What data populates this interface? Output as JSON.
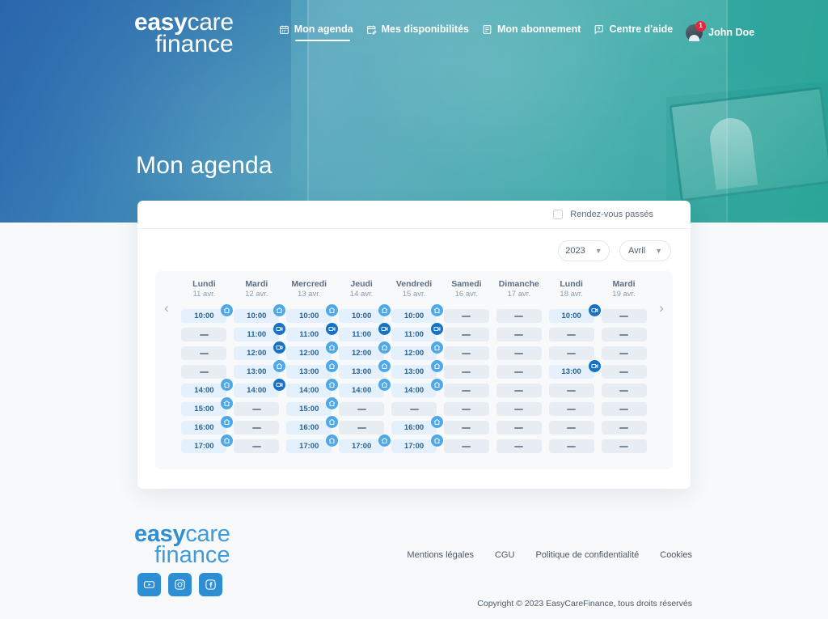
{
  "brand": {
    "logo_line1_bold": "easy",
    "logo_line1_light": "care",
    "logo_line2": "finance"
  },
  "nav": {
    "items": [
      {
        "label": "Mon agenda",
        "icon": "calendar-icon",
        "active": true
      },
      {
        "label": "Mes disponibilités",
        "icon": "calendar-edit-icon",
        "active": false
      },
      {
        "label": "Mon abonnement",
        "icon": "card-icon",
        "active": false
      },
      {
        "label": "Centre d'aide",
        "icon": "help-chat-icon",
        "active": false
      }
    ],
    "user": {
      "name": "John Doe",
      "badge_count": "1"
    }
  },
  "hero": {
    "page_title": "Mon agenda"
  },
  "card": {
    "past_appointments_label": "Rendez-vous passés",
    "past_appointments_checked": false,
    "year_select": {
      "value": "2023"
    },
    "month_select": {
      "value": "Avril"
    },
    "prev_arrow": "‹",
    "next_arrow": "›",
    "columns": [
      {
        "day": "Lundi",
        "date": "11 avr.",
        "slots": [
          {
            "time": "10:00",
            "state": "booked",
            "icon": "home"
          },
          {
            "time": "",
            "state": "free",
            "icon": ""
          },
          {
            "time": "",
            "state": "free",
            "icon": ""
          },
          {
            "time": "",
            "state": "free",
            "icon": ""
          },
          {
            "time": "14:00",
            "state": "booked",
            "icon": "home"
          },
          {
            "time": "15:00",
            "state": "booked",
            "icon": "home"
          },
          {
            "time": "16:00",
            "state": "booked",
            "icon": "home"
          },
          {
            "time": "17:00",
            "state": "booked",
            "icon": "home"
          }
        ]
      },
      {
        "day": "Mardi",
        "date": "12 avr.",
        "slots": [
          {
            "time": "10:00",
            "state": "booked",
            "icon": "home"
          },
          {
            "time": "11:00",
            "state": "booked",
            "icon": "video"
          },
          {
            "time": "12:00",
            "state": "booked",
            "icon": "video"
          },
          {
            "time": "13:00",
            "state": "booked",
            "icon": "home"
          },
          {
            "time": "14:00",
            "state": "booked",
            "icon": "video"
          },
          {
            "time": "",
            "state": "free",
            "icon": ""
          },
          {
            "time": "",
            "state": "free",
            "icon": ""
          },
          {
            "time": "",
            "state": "free",
            "icon": ""
          }
        ]
      },
      {
        "day": "Mercredi",
        "date": "13 avr.",
        "slots": [
          {
            "time": "10:00",
            "state": "booked",
            "icon": "home"
          },
          {
            "time": "11:00",
            "state": "booked",
            "icon": "video"
          },
          {
            "time": "12:00",
            "state": "booked",
            "icon": "home"
          },
          {
            "time": "13:00",
            "state": "booked",
            "icon": "home"
          },
          {
            "time": "14:00",
            "state": "booked",
            "icon": "home"
          },
          {
            "time": "15:00",
            "state": "booked",
            "icon": "home"
          },
          {
            "time": "16:00",
            "state": "booked",
            "icon": "home"
          },
          {
            "time": "17:00",
            "state": "booked",
            "icon": "home"
          }
        ]
      },
      {
        "day": "Jeudi",
        "date": "14 avr.",
        "slots": [
          {
            "time": "10:00",
            "state": "booked",
            "icon": "home"
          },
          {
            "time": "11:00",
            "state": "booked",
            "icon": "video"
          },
          {
            "time": "12:00",
            "state": "booked",
            "icon": "home"
          },
          {
            "time": "13:00",
            "state": "booked",
            "icon": "home"
          },
          {
            "time": "14:00",
            "state": "booked",
            "icon": "home"
          },
          {
            "time": "",
            "state": "free",
            "icon": ""
          },
          {
            "time": "",
            "state": "free",
            "icon": ""
          },
          {
            "time": "17:00",
            "state": "booked",
            "icon": "home"
          }
        ]
      },
      {
        "day": "Vendredi",
        "date": "15 avr.",
        "slots": [
          {
            "time": "10:00",
            "state": "booked",
            "icon": "home"
          },
          {
            "time": "11:00",
            "state": "booked",
            "icon": "video"
          },
          {
            "time": "12:00",
            "state": "booked",
            "icon": "home"
          },
          {
            "time": "13:00",
            "state": "booked",
            "icon": "home"
          },
          {
            "time": "14:00",
            "state": "booked",
            "icon": "home"
          },
          {
            "time": "",
            "state": "free",
            "icon": ""
          },
          {
            "time": "16:00",
            "state": "booked",
            "icon": "home"
          },
          {
            "time": "17:00",
            "state": "booked",
            "icon": "home"
          }
        ]
      },
      {
        "day": "Samedi",
        "date": "16 avr.",
        "slots": [
          {
            "time": "",
            "state": "free",
            "icon": ""
          },
          {
            "time": "",
            "state": "free",
            "icon": ""
          },
          {
            "time": "",
            "state": "free",
            "icon": ""
          },
          {
            "time": "",
            "state": "free",
            "icon": ""
          },
          {
            "time": "",
            "state": "free",
            "icon": ""
          },
          {
            "time": "",
            "state": "free",
            "icon": ""
          },
          {
            "time": "",
            "state": "free",
            "icon": ""
          },
          {
            "time": "",
            "state": "free",
            "icon": ""
          }
        ]
      },
      {
        "day": "Dimanche",
        "date": "17 avr.",
        "slots": [
          {
            "time": "",
            "state": "free",
            "icon": ""
          },
          {
            "time": "",
            "state": "free",
            "icon": ""
          },
          {
            "time": "",
            "state": "free",
            "icon": ""
          },
          {
            "time": "",
            "state": "free",
            "icon": ""
          },
          {
            "time": "",
            "state": "free",
            "icon": ""
          },
          {
            "time": "",
            "state": "free",
            "icon": ""
          },
          {
            "time": "",
            "state": "free",
            "icon": ""
          },
          {
            "time": "",
            "state": "free",
            "icon": ""
          }
        ]
      },
      {
        "day": "Lundi",
        "date": "18 avr.",
        "slots": [
          {
            "time": "10:00",
            "state": "booked",
            "icon": "video"
          },
          {
            "time": "",
            "state": "free",
            "icon": ""
          },
          {
            "time": "",
            "state": "free",
            "icon": ""
          },
          {
            "time": "13:00",
            "state": "booked",
            "icon": "video"
          },
          {
            "time": "",
            "state": "free",
            "icon": ""
          },
          {
            "time": "",
            "state": "free",
            "icon": ""
          },
          {
            "time": "",
            "state": "free",
            "icon": ""
          },
          {
            "time": "",
            "state": "free",
            "icon": ""
          }
        ]
      },
      {
        "day": "Mardi",
        "date": "19 avr.",
        "slots": [
          {
            "time": "",
            "state": "free",
            "icon": ""
          },
          {
            "time": "",
            "state": "free",
            "icon": ""
          },
          {
            "time": "",
            "state": "free",
            "icon": ""
          },
          {
            "time": "",
            "state": "free",
            "icon": ""
          },
          {
            "time": "",
            "state": "free",
            "icon": ""
          },
          {
            "time": "",
            "state": "free",
            "icon": ""
          },
          {
            "time": "",
            "state": "free",
            "icon": ""
          },
          {
            "time": "",
            "state": "free",
            "icon": ""
          }
        ]
      }
    ]
  },
  "footer": {
    "socials": [
      {
        "name": "youtube-icon"
      },
      {
        "name": "instagram-icon"
      },
      {
        "name": "facebook-icon"
      }
    ],
    "links": [
      "Mentions légales",
      "CGU",
      "Politique de confidentialité",
      "Cookies"
    ],
    "copyright": "Copyright ©  2023 EasyCareFinance, tous droits réservés"
  },
  "colors": {
    "brand_blue": "#2d8ed3",
    "hero_from": "#2f6fb5",
    "hero_to": "#2ba193",
    "slot_booked_bg": "#e4f1fd",
    "slot_free_bg": "#e7edf2",
    "icon_home": "#4fa9e8",
    "icon_video": "#1572c6",
    "badge_red": "#e8243c"
  }
}
